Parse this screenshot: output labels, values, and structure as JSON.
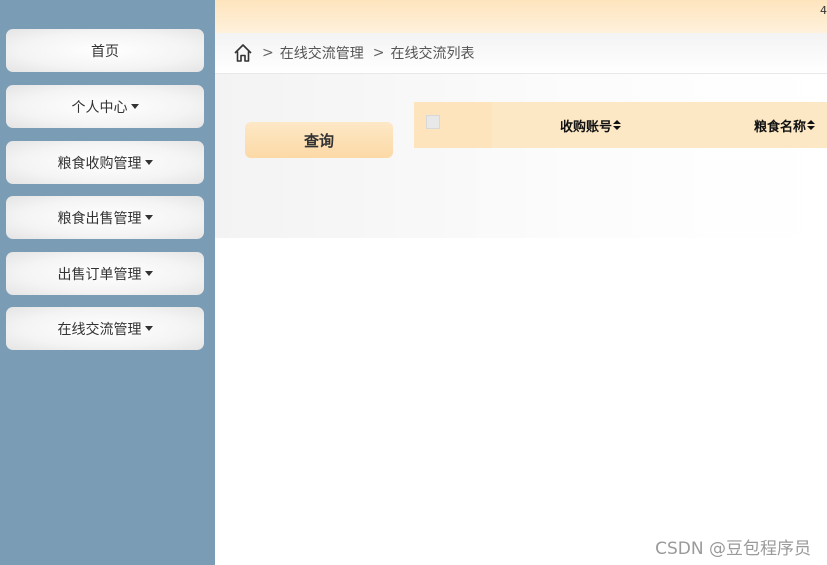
{
  "sidebar": {
    "items": [
      {
        "label": "首页",
        "has_dropdown": false
      },
      {
        "label": "个人中心",
        "has_dropdown": true
      },
      {
        "label": "粮食收购管理",
        "has_dropdown": true
      },
      {
        "label": "粮食出售管理",
        "has_dropdown": true
      },
      {
        "label": "出售订单管理",
        "has_dropdown": true
      },
      {
        "label": "在线交流管理",
        "has_dropdown": true
      }
    ]
  },
  "topbar": {
    "edge_mark": "4"
  },
  "breadcrumb": {
    "icon": "home-icon",
    "separator": ">",
    "items": [
      "在线交流管理",
      "在线交流列表"
    ]
  },
  "search": {
    "query_label": "查询"
  },
  "table": {
    "columns": [
      "收购账号",
      "粮食名称"
    ]
  },
  "watermark": "CSDN @豆包程序员",
  "colors": {
    "sidebar_bg": "#7a9cb4",
    "accent": "#fde8c6",
    "topbar": "#fde4bd"
  }
}
